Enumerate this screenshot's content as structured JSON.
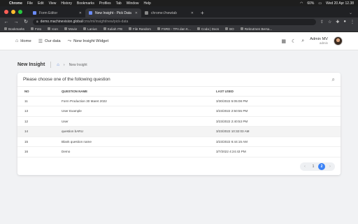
{
  "menubar": {
    "app": "Chrome",
    "items": [
      "File",
      "Edit",
      "View",
      "History",
      "Bookmarks",
      "Profiles",
      "Tab",
      "Window",
      "Help"
    ],
    "battery": "60%",
    "datetime": "Wed 20 Apr 12.38"
  },
  "tabs": [
    {
      "label": "Form Editor"
    },
    {
      "label": "New Insight - Pick Data"
    },
    {
      "label": "chrome://newtab"
    }
  ],
  "address": {
    "host": "demo.machinevision.global",
    "path": "/cms/ml/insight/new/pick-data"
  },
  "bookmarks": [
    "Bookmarks",
    "Foto",
    "Icon",
    "Movie",
    "Lanius",
    "Kuliah ITB",
    "File Random",
    "FSRD - TPA dan K...",
    "Coda | Docs",
    "BO",
    "Rekrutmen Bersa..."
  ],
  "appnav": {
    "home": "Home",
    "our_data": "Our data",
    "new_widget": "New Insight Widget",
    "user_name": "Admin MV",
    "user_role": "admin"
  },
  "page": {
    "title": "New Insight",
    "breadcrumb": "New Insight",
    "card_title": "Please choose one of the following question"
  },
  "table": {
    "headers": [
      "NO",
      "QUESTION NAME",
      "LAST USED"
    ],
    "rows": [
      {
        "no": "11",
        "name": "Form Production 30 Maret 2022",
        "used": "3/30/2022 5:05:08 PM"
      },
      {
        "no": "13",
        "name": "User Example",
        "used": "3/23/2022 2:50:55 PM"
      },
      {
        "no": "12",
        "name": "User",
        "used": "3/23/2022 2:40:53 PM"
      },
      {
        "no": "14",
        "name": "question bARU",
        "used": "3/23/2022 10:32:03 AM"
      },
      {
        "no": "15",
        "name": "Blank question name",
        "used": "3/23/2022 6:44:15 AM"
      },
      {
        "no": "16",
        "name": "Demo",
        "used": "3/7/2022 4:24:43 PM"
      }
    ]
  },
  "pagination": {
    "prev": "‹",
    "pages": [
      "1",
      "2"
    ],
    "next": "›",
    "current": "2"
  },
  "colors": {
    "accent": "#3b82f6",
    "page_bg": "#f1f2f4"
  }
}
